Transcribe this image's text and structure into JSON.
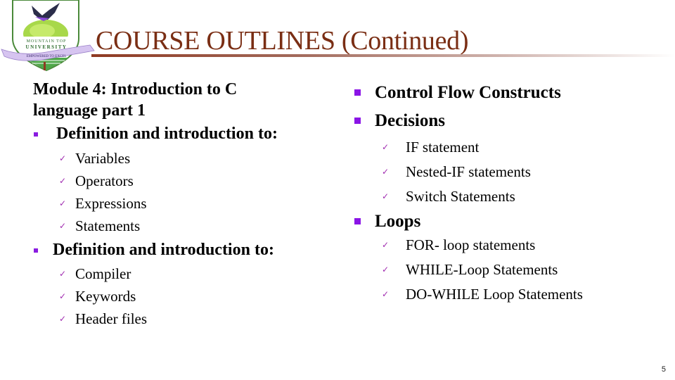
{
  "logo": {
    "name_line1": "MOUNTAIN TOP",
    "name_line2": "UNIVERSITY",
    "motto": "EMPOWERED TO EXCEL"
  },
  "title": "COURSE OUTLINES (Continued)",
  "left": {
    "module_heading_line1": "Module 4: Introduction to C",
    "module_heading_line2": "language part 1",
    "sections": [
      {
        "label": "Definition and introduction to:",
        "items": [
          "Variables",
          "Operators",
          "Expressions",
          "Statements"
        ]
      },
      {
        "label": "Definition and introduction to:",
        "items": [
          "Compiler",
          "Keywords",
          "Header files"
        ]
      }
    ]
  },
  "right": {
    "topics": [
      {
        "label": "Control Flow Constructs",
        "items": []
      },
      {
        "label": "Decisions",
        "items": [
          "IF statement",
          "Nested-IF statements",
          "Switch Statements"
        ]
      },
      {
        "label": "Loops",
        "items": [
          "FOR- loop statements",
          "WHILE-Loop Statements",
          "DO-WHILE Loop Statements"
        ]
      }
    ]
  },
  "icons": {
    "bullet_l1": "square-bullet-icon",
    "bullet_l2": "checkmark-icon",
    "check_glyph": "✓"
  },
  "colors": {
    "title": "#7a2e14",
    "bullet": "#8a14e6",
    "check": "#a02bb0"
  },
  "page_number": "5"
}
